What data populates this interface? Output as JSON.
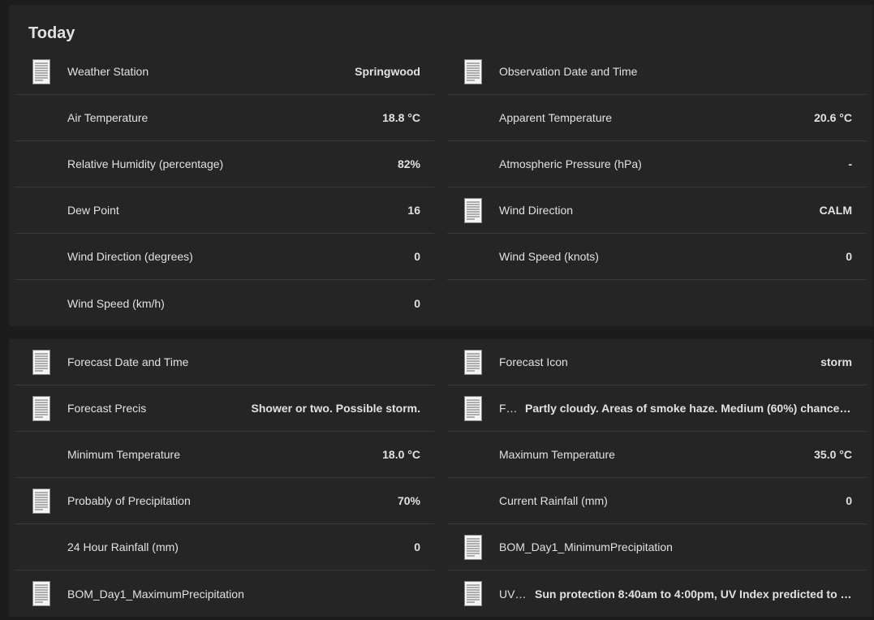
{
  "today": {
    "title": "Today",
    "left": [
      {
        "label": "Weather Station",
        "value": "Springwood",
        "icon": "document-icon"
      },
      {
        "label": "Air Temperature",
        "value": "18.8 °C",
        "icon": ""
      },
      {
        "label": "Relative Humidity (percentage)",
        "value": "82%",
        "icon": ""
      },
      {
        "label": "Dew Point",
        "value": "16",
        "icon": ""
      },
      {
        "label": "Wind Direction (degrees)",
        "value": "0",
        "icon": ""
      },
      {
        "label": "Wind Speed (km/h)",
        "value": "0",
        "icon": ""
      }
    ],
    "right": [
      {
        "label": "Observation Date and Time",
        "value": "",
        "icon": "document-icon"
      },
      {
        "label": "Apparent Temperature",
        "value": "20.6 °C",
        "icon": ""
      },
      {
        "label": "Atmospheric Pressure (hPa)",
        "value": "-",
        "icon": ""
      },
      {
        "label": "Wind Direction",
        "value": "CALM",
        "icon": "document-icon"
      },
      {
        "label": "Wind Speed (knots)",
        "value": "0",
        "icon": ""
      }
    ]
  },
  "forecast": {
    "left": [
      {
        "label": "Forecast Date and Time",
        "value": "",
        "icon": "document-icon"
      },
      {
        "label": "Forecast Precis",
        "value": "Shower or two. Possible storm.",
        "icon": "document-icon"
      },
      {
        "label": "Minimum Temperature",
        "value": "18.0 °C",
        "icon": ""
      },
      {
        "label": "Probably of Precipitation",
        "value": "70%",
        "icon": "document-icon"
      },
      {
        "label": "24 Hour Rainfall (mm)",
        "value": "0",
        "icon": ""
      },
      {
        "label": "BOM_Day1_MaximumPrecipitation",
        "value": "",
        "icon": "document-icon"
      }
    ],
    "right": [
      {
        "label": "Forecast Icon",
        "value": "storm",
        "icon": "document-icon"
      },
      {
        "label": "F…",
        "value": "Partly cloudy. Areas of smoke haze. Medium (60%) chance…",
        "icon": "document-icon"
      },
      {
        "label": "Maximum Temperature",
        "value": "35.0 °C",
        "icon": ""
      },
      {
        "label": "Current Rainfall (mm)",
        "value": "0",
        "icon": ""
      },
      {
        "label": "BOM_Day1_MinimumPrecipitation",
        "value": "",
        "icon": "document-icon"
      },
      {
        "label": "UV …",
        "value": "Sun protection 8:40am to 4:00pm, UV Index predicted to …",
        "icon": "document-icon"
      }
    ]
  }
}
